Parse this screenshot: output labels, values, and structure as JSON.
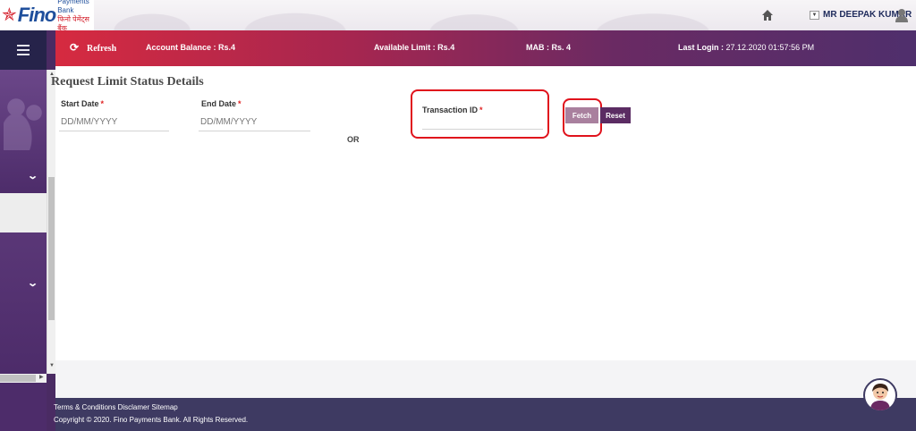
{
  "header": {
    "logo_brand": "Fino",
    "logo_line1": "Payments Bank",
    "logo_line2": "फिनो पेमेंट्स बैंक",
    "user_name": "MR DEEPAK KUMAR"
  },
  "statusbar": {
    "refresh_label": "Refresh",
    "account_balance": "Account Balance : Rs.4",
    "available_limit": "Available Limit : Rs.4",
    "mab": "MAB : Rs. 4",
    "last_login_label": "Last Login :",
    "last_login_value": " 27.12.2020 01:57:56 PM"
  },
  "page": {
    "title": "Request Limit Status Details",
    "start_date_label": "Start Date",
    "start_date_placeholder": "DD/MM/YYYY",
    "end_date_label": "End Date",
    "end_date_placeholder": "DD/MM/YYYY",
    "or_label": "OR",
    "transaction_id_label": "Transaction ID",
    "required_mark": "*",
    "fetch_label": "Fetch",
    "reset_label": "Reset"
  },
  "footer": {
    "links": "Terms & Conditions Disclamer Sitemap",
    "copyright": "Copyright © 2020. Fino Payments Bank. All Rights Reserved."
  },
  "colors": {
    "primary_purple": "#4a2b63",
    "accent_red": "#d62a40",
    "footer_navy": "#3e3a62",
    "fetch_button": "#a9809e",
    "reset_button": "#5b2c63",
    "highlight_red": "#e0121c"
  },
  "icons": {
    "home": "home-icon",
    "user": "user-icon",
    "menu": "hamburger-menu-icon",
    "refresh": "refresh-icon",
    "chevron": "chevron-down-icon",
    "chatbot": "chatbot-avatar-icon"
  }
}
